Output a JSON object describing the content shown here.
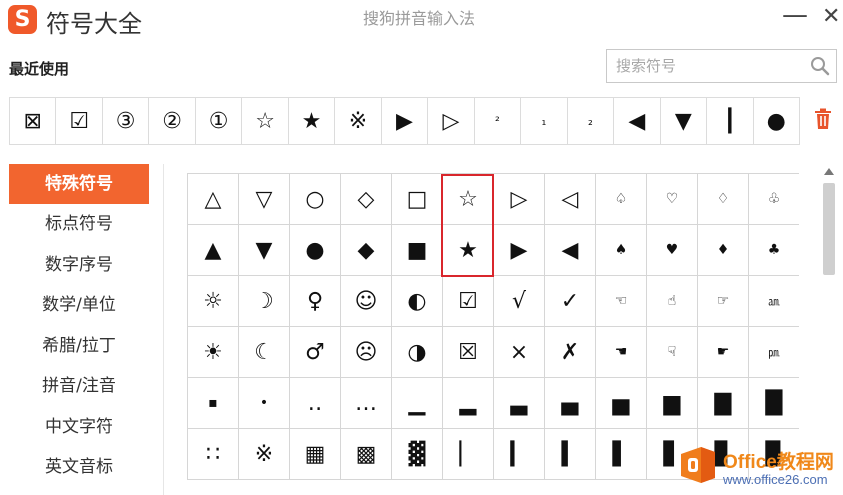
{
  "window": {
    "app_logo": "S",
    "app_title": "符号大全",
    "subtitle": "搜狗拼音输入法",
    "minimize_label": "—",
    "close_label": "✕"
  },
  "recent": {
    "title": "最近使用",
    "symbols": [
      "⊠",
      "☑",
      "③",
      "②",
      "①",
      "☆",
      "★",
      "※",
      "▶",
      "▷",
      "²",
      "₁",
      "₂",
      "◀",
      "▼",
      "┃",
      "●"
    ]
  },
  "search": {
    "placeholder": "搜索符号",
    "value": ""
  },
  "categories": [
    {
      "label": "特殊符号",
      "active": true
    },
    {
      "label": "标点符号"
    },
    {
      "label": "数字序号"
    },
    {
      "label": "数学/单位"
    },
    {
      "label": "希腊/拉丁"
    },
    {
      "label": "拼音/注音"
    },
    {
      "label": "中文字符"
    },
    {
      "label": "英文音标"
    }
  ],
  "grid": {
    "rows": [
      [
        "△",
        "▽",
        "○",
        "◇",
        "□",
        "☆",
        "▷",
        "◁",
        "♤",
        "♡",
        "♢",
        "♧"
      ],
      [
        "▲",
        "▼",
        "●",
        "◆",
        "■",
        "★",
        "▶",
        "◀",
        "♠",
        "♥",
        "♦",
        "♣"
      ],
      [
        "☼",
        "☽",
        "♀",
        "☺",
        "◐",
        "☑",
        "√",
        "✓",
        "☜",
        "☝",
        "☞",
        "㏂"
      ],
      [
        "☀",
        "☾",
        "♂",
        "☹",
        "◑",
        "☒",
        "×",
        "✗",
        "☚",
        "☟",
        "☛",
        "㏘"
      ],
      [
        "▪",
        "•",
        "‥",
        "…",
        "▁",
        "▂",
        "▃",
        "▄",
        "▅",
        "▆",
        "▇",
        "█"
      ],
      [
        "∷",
        "※",
        "▦",
        "▩",
        "▓",
        "▏",
        "▎",
        "▍",
        "▌",
        "▋",
        "▊",
        "▉"
      ]
    ],
    "selected_symbol": "☆"
  },
  "watermark": {
    "title": "Office教程网",
    "url": "www.office26.com"
  },
  "colors": {
    "accent": "#f2652f",
    "highlight_border": "#d9262c",
    "watermark_orange": "#f0881a",
    "watermark_blue": "#4c6fb4"
  },
  "icons": {
    "search": "magnifier-icon",
    "trash": "trash-icon"
  }
}
